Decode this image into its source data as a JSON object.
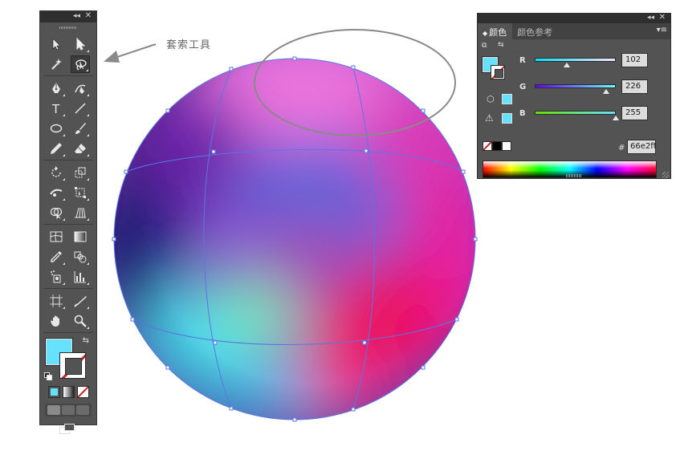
{
  "annotation": {
    "label": "套索工具",
    "arrow_icon": "arrow-left-icon"
  },
  "tools_panel": {
    "titlebar": {
      "collapse": "◂◂",
      "close": "✕"
    },
    "rows": [
      [
        "selection-tool-icon",
        "direct-selection-tool-icon"
      ],
      [
        "magic-wand-tool-icon",
        "lasso-tool-icon"
      ],
      [
        "pen-tool-icon",
        "curvature-tool-icon"
      ],
      [
        "type-tool-icon",
        "line-segment-tool-icon"
      ],
      [
        "ellipse-tool-icon",
        "paintbrush-tool-icon"
      ],
      [
        "pencil-tool-icon",
        "eraser-tool-icon"
      ],
      [
        "rotate-tool-icon",
        "scale-tool-icon"
      ],
      [
        "width-tool-icon",
        "free-transform-tool-icon"
      ],
      [
        "shape-builder-tool-icon",
        "perspective-grid-tool-icon"
      ],
      [
        "mesh-tool-icon",
        "gradient-tool-icon"
      ],
      [
        "eyedropper-tool-icon",
        "blend-tool-icon"
      ],
      [
        "symbol-sprayer-tool-icon",
        "column-graph-tool-icon"
      ],
      [
        "artboard-tool-icon",
        "slice-tool-icon"
      ],
      [
        "hand-tool-icon",
        "zoom-tool-icon"
      ]
    ],
    "active_tool": "lasso-tool-icon",
    "fill_color": "#66e2ff",
    "stroke": "none",
    "swap_icon": "⇆"
  },
  "color_panel": {
    "titlebar": {
      "collapse": "◂◂",
      "close": "✕"
    },
    "tabs": [
      {
        "label": "颜色",
        "active": true
      },
      {
        "label": "颜色参考",
        "active": false
      }
    ],
    "menu_icon": "▾≡",
    "sliders": [
      {
        "label": "R",
        "value": "102",
        "fraction": 0.4
      },
      {
        "label": "G",
        "value": "226",
        "fraction": 0.886
      },
      {
        "label": "B",
        "value": "255",
        "fraction": 1.0
      }
    ],
    "hex_label": "#",
    "hex_value": "66e2ff",
    "fill_color": "#66e2ff",
    "warning_icon": "warning-icon",
    "cube_icon": "web-safe-cube-icon"
  },
  "canvas": {
    "sphere_colors": {
      "top": "#ec72dc",
      "upper_mid": "#6a5bd8",
      "left_dark": "#1c1a7a",
      "green": "#73f1b6",
      "cyan": "#47d8f2",
      "pink": "#f0328f",
      "red": "#f01158",
      "right": "#ea1d9f"
    },
    "mesh_line_color": "#5a76e0",
    "ellipse_stroke": "#8a8a8a"
  }
}
